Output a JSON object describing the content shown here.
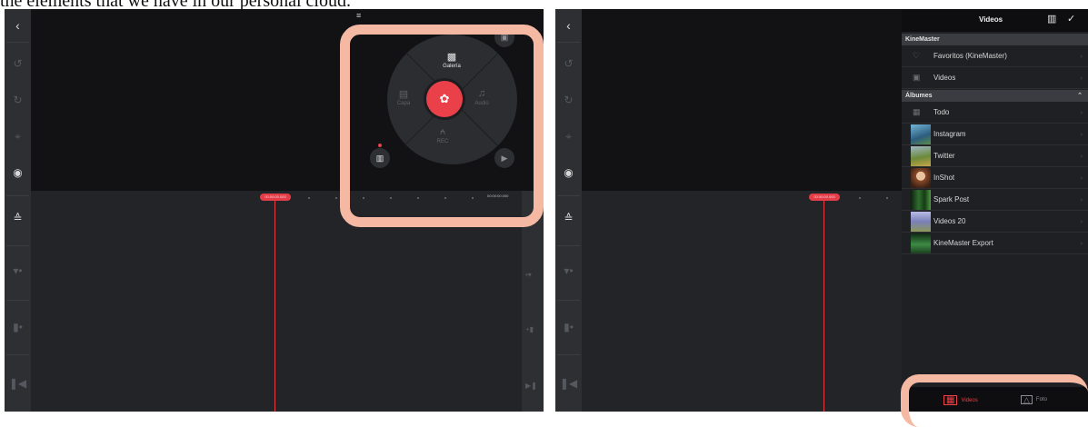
{
  "caption": "the elements that we have in our personal cloud.",
  "left_panel": {
    "rail_icons": [
      "back-icon",
      "undo-icon",
      "redo-icon",
      "crop-icon",
      "record-icon",
      "split-icon",
      "audio-level-icon",
      "track-icon",
      "rewind-icon"
    ],
    "timecode_left": "00:00:00.000",
    "timecode_right": "00:00:00.000",
    "radial_menu": {
      "top_label": "Galería",
      "left_label": "Capa",
      "right_label": "Audio",
      "bottom_label": "REC",
      "center_icon": "camera-icon"
    }
  },
  "right_panel": {
    "timecode": "00:00:00.000",
    "browser": {
      "title": "Videos",
      "sections": [
        {
          "label": "KineMaster",
          "items": [
            {
              "label": "Favoritos (KineMaster)",
              "icon": "heart-icon"
            },
            {
              "label": "Videos",
              "icon": "video-file-icon"
            }
          ]
        },
        {
          "label": "Álbumes",
          "items": [
            {
              "label": "Todo",
              "icon": "film-icon"
            },
            {
              "label": "Instagram",
              "thumb_color": "#3a7aa6"
            },
            {
              "label": "Twitter",
              "thumb_color": "#6b8a3a"
            },
            {
              "label": "InShot",
              "thumb_color": "#b2704a"
            },
            {
              "label": "Spark Post",
              "thumb_color": "#2b5e2b"
            },
            {
              "label": "Videos 20",
              "thumb_color": "#7a80b8"
            },
            {
              "label": "KineMaster Export",
              "thumb_color": "#2f6a38"
            }
          ]
        }
      ],
      "bottom_tabs": [
        {
          "label": "Videos",
          "active": true
        },
        {
          "label": "Foto",
          "active": false
        }
      ]
    }
  },
  "colors": {
    "accent": "#e9404a",
    "highlight": "#f5b9a3"
  }
}
